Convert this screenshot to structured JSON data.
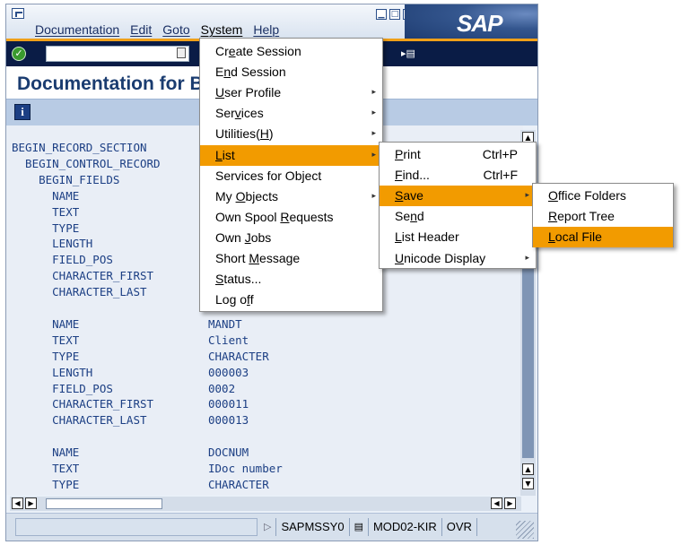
{
  "menubar": {
    "items": [
      {
        "label": "Documentation"
      },
      {
        "label": "Edit"
      },
      {
        "label": "Goto"
      },
      {
        "label": "System"
      },
      {
        "label": "Help"
      }
    ],
    "brand": "SAP"
  },
  "title": "Documentation for B",
  "code_lines": [
    {
      "col1": "BEGIN_RECORD_SECTION",
      "col2": ""
    },
    {
      "col1": "  BEGIN_CONTROL_RECORD",
      "col2": ""
    },
    {
      "col1": "    BEGIN_FIELDS",
      "col2": ""
    },
    {
      "col1": "      NAME",
      "col2": ""
    },
    {
      "col1": "      TEXT",
      "col2": ""
    },
    {
      "col1": "      TYPE",
      "col2": ""
    },
    {
      "col1": "      LENGTH",
      "col2": ""
    },
    {
      "col1": "      FIELD_POS",
      "col2": ""
    },
    {
      "col1": "      CHARACTER_FIRST",
      "col2": ""
    },
    {
      "col1": "      CHARACTER_LAST",
      "col2": ""
    },
    {
      "col1": "",
      "col2": ""
    },
    {
      "col1": "      NAME",
      "col2": "MANDT"
    },
    {
      "col1": "      TEXT",
      "col2": "Client"
    },
    {
      "col1": "      TYPE",
      "col2": "CHARACTER"
    },
    {
      "col1": "      LENGTH",
      "col2": "000003"
    },
    {
      "col1": "      FIELD_POS",
      "col2": "0002"
    },
    {
      "col1": "      CHARACTER_FIRST",
      "col2": "000011"
    },
    {
      "col1": "      CHARACTER_LAST",
      "col2": "000013"
    },
    {
      "col1": "",
      "col2": ""
    },
    {
      "col1": "      NAME",
      "col2": "DOCNUM"
    },
    {
      "col1": "      TEXT",
      "col2": "IDoc number"
    },
    {
      "col1": "      TYPE",
      "col2": "CHARACTER"
    }
  ],
  "system_menu": [
    {
      "label": "Create Session",
      "pre": "Cr",
      "acc": "e",
      "post": "ate Session",
      "submenu": false
    },
    {
      "label": "End Session",
      "pre": "E",
      "acc": "n",
      "post": "d Session",
      "submenu": false
    },
    {
      "label": "User Profile",
      "pre": "",
      "acc": "U",
      "post": "ser Profile",
      "submenu": true
    },
    {
      "label": "Services",
      "pre": "Ser",
      "acc": "v",
      "post": "ices",
      "submenu": true
    },
    {
      "label": "Utilities(H)",
      "pre": "Utilities(",
      "acc": "H",
      "post": ")",
      "submenu": true
    },
    {
      "label": "List",
      "pre": "",
      "acc": "L",
      "post": "ist",
      "submenu": true,
      "highlight": true
    },
    {
      "label": "Services for Object",
      "pre": "Services for Ob",
      "acc": "j",
      "post": "ect",
      "submenu": false
    },
    {
      "label": "My Objects",
      "pre": "My ",
      "acc": "O",
      "post": "bjects",
      "submenu": true
    },
    {
      "label": "Own Spool Requests",
      "pre": "Own Spool ",
      "acc": "R",
      "post": "equests",
      "submenu": false
    },
    {
      "label": "Own Jobs",
      "pre": "Own ",
      "acc": "J",
      "post": "obs",
      "submenu": false
    },
    {
      "label": "Short Message",
      "pre": "Short ",
      "acc": "M",
      "post": "essage",
      "submenu": false
    },
    {
      "label": "Status...",
      "pre": "",
      "acc": "S",
      "post": "tatus...",
      "submenu": false
    },
    {
      "label": "Log off",
      "pre": "Log o",
      "acc": "f",
      "post": "f",
      "submenu": false
    }
  ],
  "list_menu": [
    {
      "label": "Print",
      "pre": "",
      "acc": "P",
      "post": "rint",
      "shortcut": "Ctrl+P",
      "submenu": false
    },
    {
      "label": "Find...",
      "pre": "",
      "acc": "F",
      "post": "ind...",
      "shortcut": "Ctrl+F",
      "submenu": false
    },
    {
      "label": "Save",
      "pre": "",
      "acc": "S",
      "post": "ave",
      "shortcut": "",
      "submenu": true,
      "highlight": true
    },
    {
      "label": "Send",
      "pre": "Se",
      "acc": "n",
      "post": "d",
      "shortcut": "",
      "submenu": false
    },
    {
      "label": "List Header",
      "pre": "",
      "acc": "L",
      "post": "ist Header",
      "shortcut": "",
      "submenu": false
    },
    {
      "label": "Unicode Display",
      "pre": "",
      "acc": "U",
      "post": "nicode Display",
      "shortcut": "",
      "submenu": true
    }
  ],
  "save_menu": [
    {
      "label": "Office Folders",
      "pre": "",
      "acc": "O",
      "post": "ffice Folders"
    },
    {
      "label": "Report Tree",
      "pre": "",
      "acc": "R",
      "post": "eport Tree"
    },
    {
      "label": "Local File",
      "pre": "",
      "acc": "L",
      "post": "ocal File",
      "highlight": true
    }
  ],
  "status": {
    "program": "SAPMSSY0",
    "server": "MOD02-KIR",
    "mode": "OVR"
  },
  "colors": {
    "highlight": "#f29b00",
    "accent_orange": "#f0a019",
    "title_blue": "#1a3c70",
    "code_blue": "#1c3f84"
  },
  "icons": {
    "ok": "green-check-icon",
    "info": "info-icon",
    "submenu": "triangle-right-icon"
  }
}
